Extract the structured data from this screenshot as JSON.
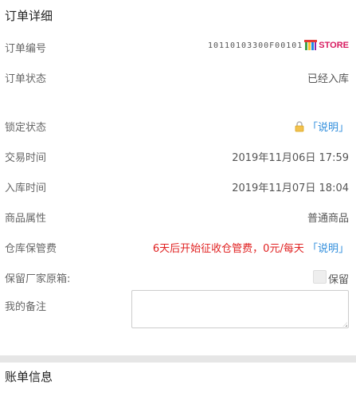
{
  "header": {
    "title": "订单详细"
  },
  "rows": {
    "order_no": {
      "label": "订单编号",
      "value": "10110103300F00101",
      "logo_text": "STORE"
    },
    "order_status": {
      "label": "订单状态",
      "value": "已经入库"
    },
    "lock_status": {
      "label": "锁定状态",
      "link": "「说明」"
    },
    "trade_time": {
      "label": "交易时间",
      "value": "2019年11月06日 17:59"
    },
    "stock_time": {
      "label": "入库时间",
      "value": "2019年11月07日 18:04"
    },
    "attribute": {
      "label": "商品属性",
      "value": "普通商品"
    },
    "storage_fee": {
      "label": "仓库保管费",
      "notice": "6天后开始征收仓管费，0元/每天",
      "link": "「说明」"
    },
    "keep_box": {
      "label": "保留厂家原箱:",
      "checkbox_label": "保留",
      "checked": false
    },
    "remark": {
      "label": "我的备注",
      "placeholder": ""
    }
  },
  "bill": {
    "title": "账单信息"
  },
  "colors": {
    "link": "#2f8ddc",
    "notice": "#e02020",
    "logo": "#d81b60"
  }
}
